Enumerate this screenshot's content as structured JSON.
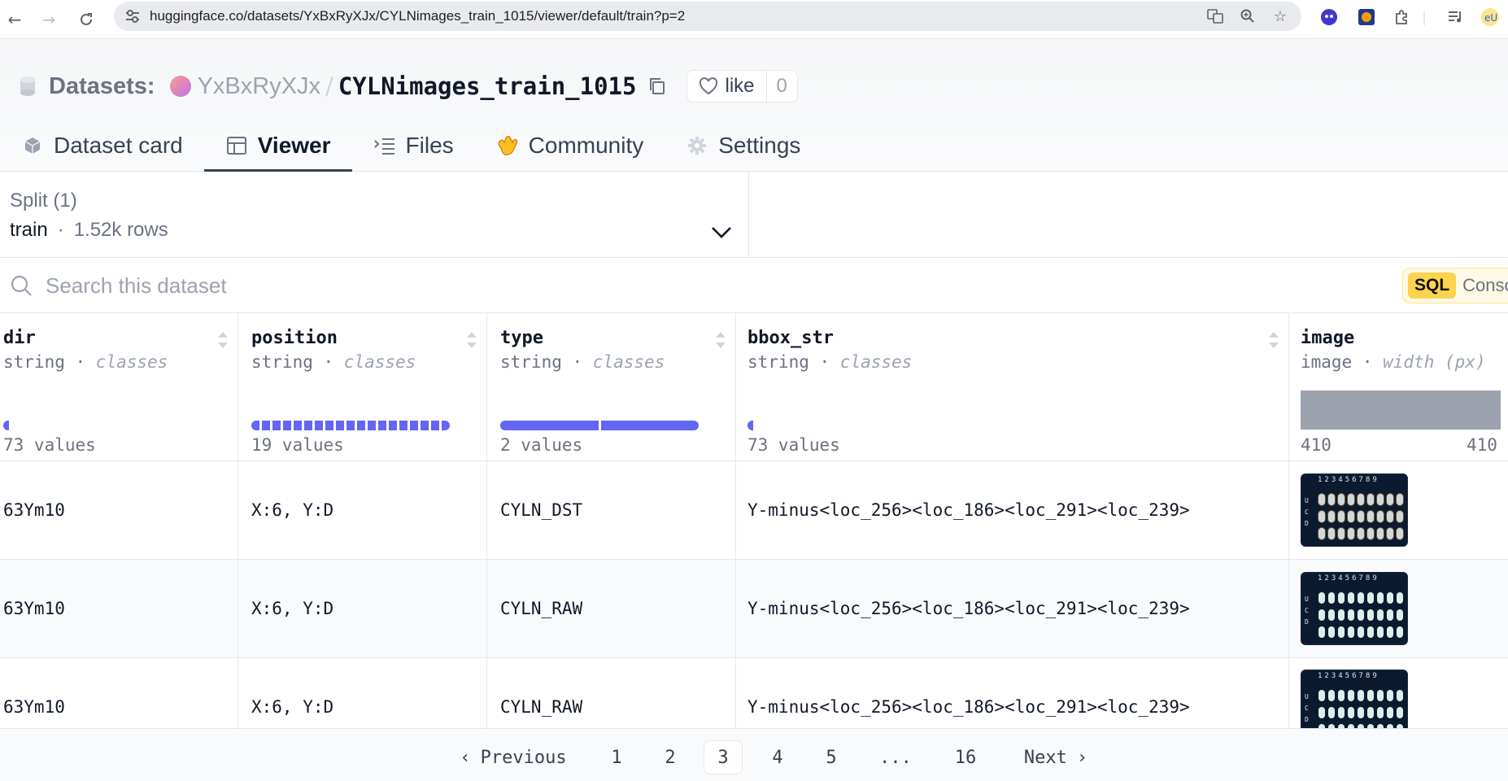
{
  "browser": {
    "url": "huggingface.co/datasets/YxBxRyXJx/CYLNimages_train_1015/viewer/default/train?p=2"
  },
  "header": {
    "section_label": "Datasets:",
    "owner": "YxBxRyXJx",
    "separator": "/",
    "repo": "CYLNimages_train_1015",
    "like_label": "like",
    "like_count": "0"
  },
  "tabs": [
    {
      "label": "Dataset card",
      "icon": "cube-icon"
    },
    {
      "label": "Viewer",
      "icon": "table-icon",
      "active": true
    },
    {
      "label": "Files",
      "icon": "files-icon"
    },
    {
      "label": "Community",
      "icon": "community-icon"
    },
    {
      "label": "Settings",
      "icon": "gear-icon"
    }
  ],
  "split": {
    "title": "Split (1)",
    "name": "train",
    "separator": "·",
    "rows": "1.52k rows"
  },
  "search": {
    "placeholder": "Search this dataset",
    "sql_badge": "SQL",
    "sql_label": "Console"
  },
  "columns": [
    {
      "name": "dir",
      "type": "string",
      "kind": "classes",
      "stats": "73 values"
    },
    {
      "name": "position",
      "type": "string",
      "kind": "classes",
      "stats": "19 values"
    },
    {
      "name": "type",
      "type": "string",
      "kind": "classes",
      "stats": "2 values"
    },
    {
      "name": "bbox_str",
      "type": "string",
      "kind": "classes",
      "stats": "73 values"
    },
    {
      "name": "image",
      "type": "image",
      "kind": "width (px)",
      "min": "410",
      "max": "410"
    }
  ],
  "rows": [
    {
      "dir": "63Ym10",
      "position": "X:6, Y:D",
      "type": "CYLN_DST",
      "bbox_str": "Y-minus<loc_256><loc_186><loc_291><loc_239>"
    },
    {
      "dir": "63Ym10",
      "position": "X:6, Y:D",
      "type": "CYLN_RAW",
      "bbox_str": "Y-minus<loc_256><loc_186><loc_291><loc_239>"
    },
    {
      "dir": "63Ym10",
      "position": "X:6, Y:D",
      "type": "CYLN_RAW",
      "bbox_str": "Y-minus<loc_256><loc_186><loc_291><loc_239>"
    }
  ],
  "thumbnail": {
    "column_numbers": "123456789",
    "row_letters": [
      "U",
      "C",
      "D"
    ]
  },
  "pagination": {
    "previous": "Previous",
    "pages": [
      "1",
      "2",
      "3",
      "4",
      "5",
      "...",
      "16"
    ],
    "current": "3",
    "next": "Next"
  },
  "colors": {
    "accent": "#6366f1",
    "hist_gray": "#9ca3af"
  }
}
